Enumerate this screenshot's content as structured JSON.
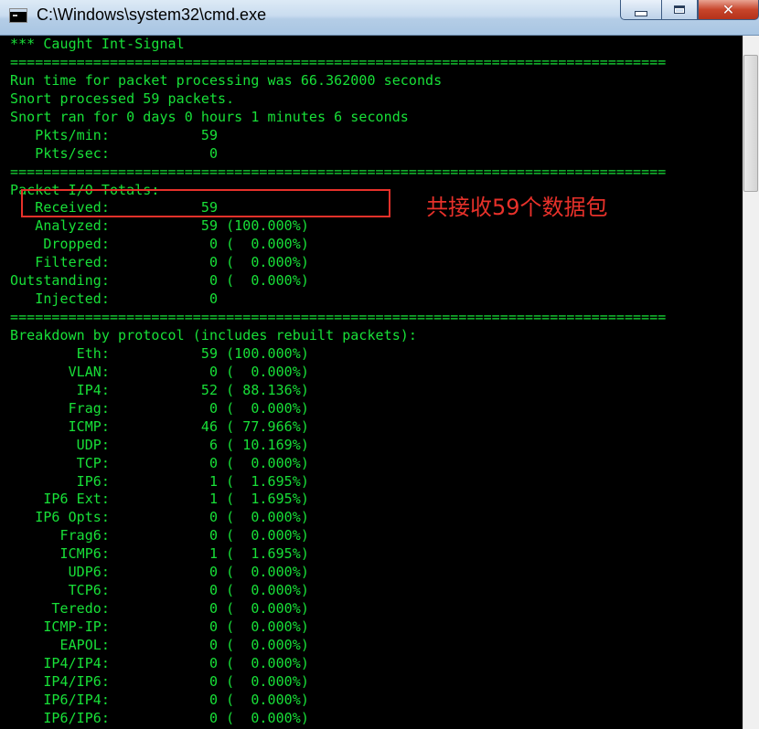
{
  "window": {
    "title": "C:\\Windows\\system32\\cmd.exe",
    "icon": "cmd-console-icon",
    "buttons": {
      "minimize": "minimize-icon",
      "maximize": "maximize-icon",
      "close": "close-icon"
    }
  },
  "colors": {
    "console_text": "#18e038",
    "console_bg": "#000000",
    "annotation": "#e7312a"
  },
  "console": {
    "lines": [
      "*** Caught Int-Signal",
      "===============================================================================",
      "Run time for packet processing was 66.362000 seconds",
      "Snort processed 59 packets.",
      "Snort ran for 0 days 0 hours 1 minutes 6 seconds",
      "   Pkts/min:           59",
      "   Pkts/sec:            0",
      "===============================================================================",
      "Packet I/O Totals:",
      "   Received:           59",
      "   Analyzed:           59 (100.000%)",
      "    Dropped:            0 (  0.000%)",
      "   Filtered:            0 (  0.000%)",
      "Outstanding:            0 (  0.000%)",
      "   Injected:            0",
      "===============================================================================",
      "Breakdown by protocol (includes rebuilt packets):",
      "        Eth:           59 (100.000%)",
      "       VLAN:            0 (  0.000%)",
      "        IP4:           52 ( 88.136%)",
      "       Frag:            0 (  0.000%)",
      "       ICMP:           46 ( 77.966%)",
      "        UDP:            6 ( 10.169%)",
      "        TCP:            0 (  0.000%)",
      "        IP6:            1 (  1.695%)",
      "    IP6 Ext:            1 (  1.695%)",
      "   IP6 Opts:            0 (  0.000%)",
      "      Frag6:            0 (  0.000%)",
      "      ICMP6:            1 (  1.695%)",
      "       UDP6:            0 (  0.000%)",
      "       TCP6:            0 (  0.000%)",
      "     Teredo:            0 (  0.000%)",
      "    ICMP-IP:            0 (  0.000%)",
      "      EAPOL:            0 (  0.000%)",
      "    IP4/IP4:            0 (  0.000%)",
      "    IP4/IP6:            0 (  0.000%)",
      "    IP6/IP4:            0 (  0.000%)",
      "    IP6/IP6:            0 (  0.000%)"
    ]
  },
  "annotation": {
    "text": "共接收59个数据包"
  }
}
